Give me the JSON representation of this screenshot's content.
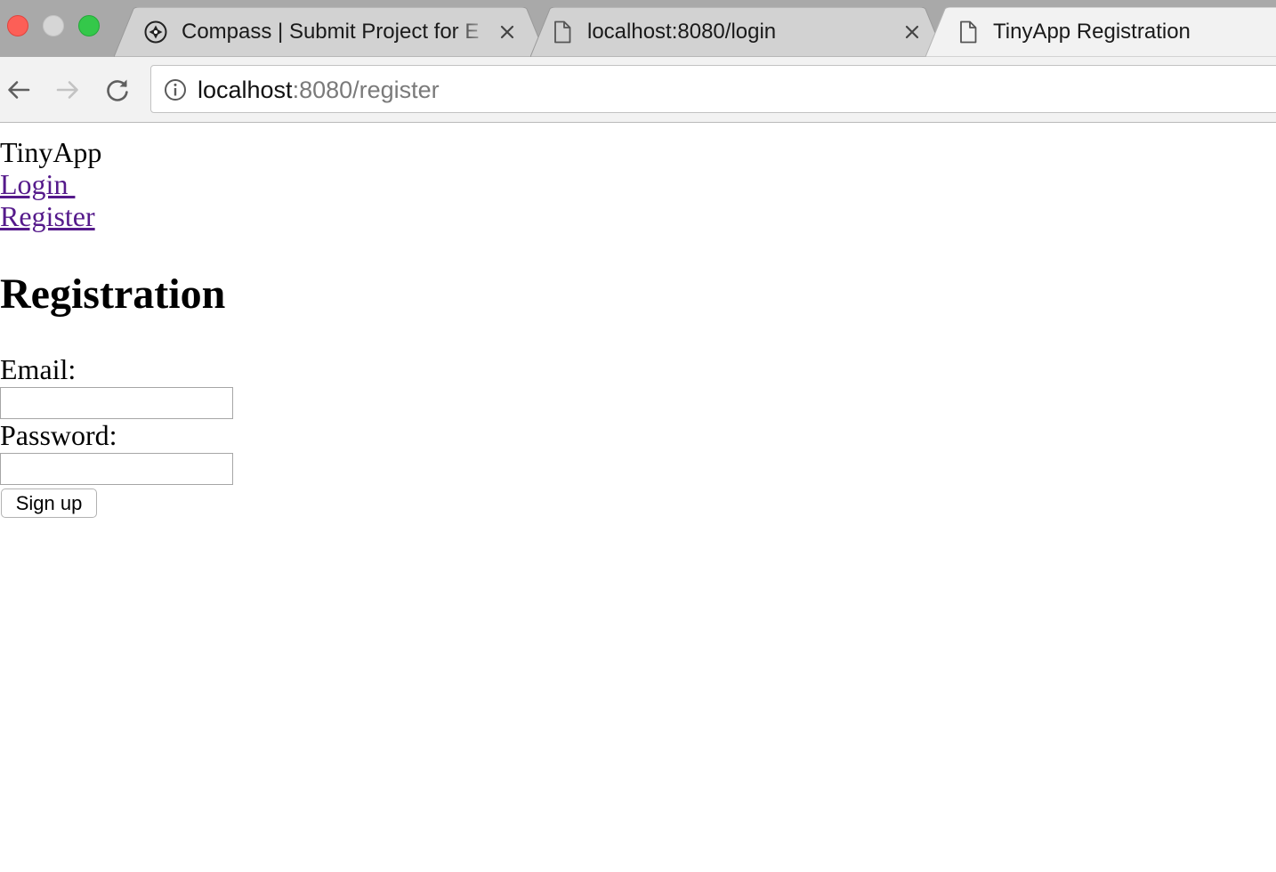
{
  "browser": {
    "tabs": [
      {
        "title": "Compass | Submit Project for E",
        "icon": "compass-icon",
        "active": false,
        "closable": true
      },
      {
        "title": "localhost:8080/login",
        "icon": "document-icon",
        "active": false,
        "closable": true
      },
      {
        "title": "TinyApp Registration",
        "icon": "document-icon",
        "active": true,
        "closable": false
      }
    ],
    "address_bar": {
      "host": "localhost",
      "rest": ":8080/register",
      "icon": "info-icon"
    },
    "nav_icons": [
      "back-arrow-icon",
      "forward-arrow-icon",
      "reload-icon"
    ]
  },
  "page": {
    "brand": "TinyApp",
    "nav": {
      "login": "Login ",
      "register": "Register"
    },
    "heading": "Registration",
    "form": {
      "email_label": "Email:",
      "email_value": "",
      "password_label": "Password:",
      "password_value": "",
      "submit_label": "Sign up"
    }
  },
  "colors": {
    "tabstrip_bg": "#a9a9a9",
    "toolbar_bg": "#f2f2f2",
    "link_visited": "#551a8b"
  }
}
